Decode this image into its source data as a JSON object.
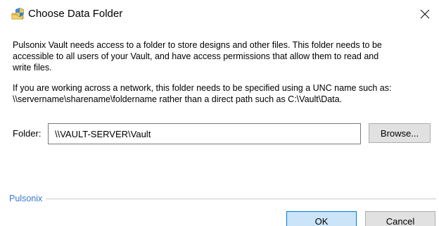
{
  "window": {
    "title": "Choose Data Folder",
    "icon": "folder-shield-icon",
    "close_icon": "close-icon"
  },
  "message": {
    "paragraph1": [
      "Pulsonix Vault needs access to a folder to store designs and other files. This folder needs to be",
      "accessible to all users of your Vault, and have access permissions that allow them to read and",
      "write files."
    ],
    "paragraph2": [
      "If you are working across a network, this folder needs to be specified using a UNC name such as:",
      "\\\\servername\\sharename\\foldername rather than a direct path such as C:\\Vault\\Data."
    ]
  },
  "folder": {
    "label": "Folder:",
    "value": "\\\\VAULT-SERVER\\Vault",
    "browse_label": "Browse..."
  },
  "footer": {
    "group_label": "Pulsonix",
    "ok_label": "OK",
    "cancel_label": "Cancel"
  },
  "colors": {
    "accent": "#0078d7",
    "group_label": "#3a78c7",
    "ok_background": "#cce4f7",
    "button_background": "#e1e1e1"
  }
}
